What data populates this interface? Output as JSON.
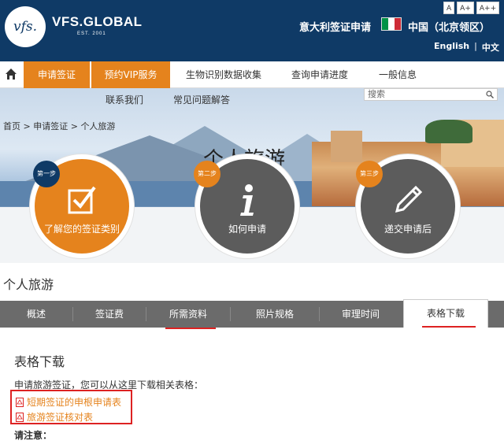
{
  "header": {
    "logo_text": "vfs.",
    "brand": "VFS.GLOBAL",
    "est": "EST. 2001",
    "font_sizes": [
      "A",
      "A+",
      "A++"
    ],
    "site_title": "意大利签证申请",
    "country": "中国（北京领区）",
    "lang_en": "English",
    "lang_sep": "|",
    "lang_zh": "中文"
  },
  "nav": {
    "items": [
      "申请签证",
      "预约VIP服务",
      "生物识别数据收集",
      "查询申请进度",
      "一般信息"
    ],
    "sub_items": [
      "联系我们",
      "常见问题解答"
    ],
    "search_placeholder": "搜索"
  },
  "breadcrumb": {
    "items": [
      "首页",
      "申请签证",
      "个人旅游"
    ],
    "sep": " > "
  },
  "banner_title": "个人旅游",
  "steps": [
    {
      "badge": "第一步",
      "label": "了解您的签证类别",
      "color": "#e5831d"
    },
    {
      "badge": "第二步",
      "label": "如何申请",
      "color": "#5c5c5c"
    },
    {
      "badge": "第三步",
      "label": "递交申请后",
      "color": "#5c5c5c"
    }
  ],
  "section_title": "个人旅游",
  "tabs": [
    "概述",
    "签证费",
    "所需资料",
    "照片规格",
    "审理时间",
    "表格下载"
  ],
  "content": {
    "title": "表格下载",
    "intro": "申请旅游签证，您可以从这里下载相关表格：",
    "links": [
      "短期签证的申根申请表",
      "旅游签证核对表"
    ],
    "notice": "请注意："
  },
  "colors": {
    "header_bg": "#0f3a66",
    "accent": "#e5831d",
    "tab_bg": "#6b6b6b",
    "highlight_red": "#d22222",
    "flag": [
      "#009246",
      "#ffffff",
      "#ce2b37"
    ]
  }
}
